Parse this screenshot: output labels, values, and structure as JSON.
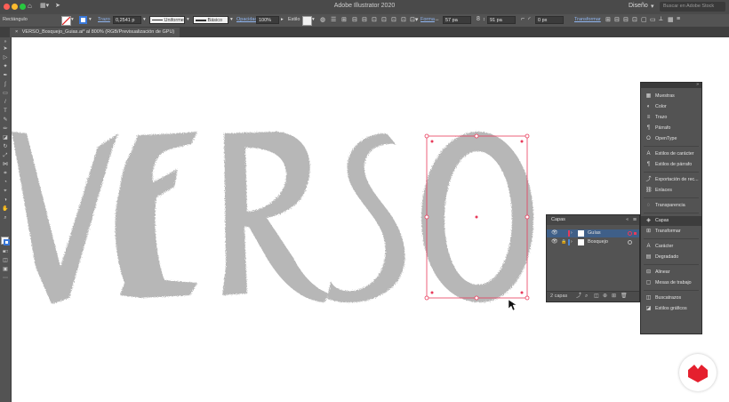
{
  "app": {
    "title": "Adobe Illustrator 2020",
    "workspace": "Diseño",
    "stock_search_placeholder": "Buscar en Adobe Stock"
  },
  "control_bar": {
    "object_type": "Rectángulo",
    "stroke_label": "Trazo",
    "stroke_value": "0,2541 p",
    "profile": "Uniforme",
    "brush": "Básico",
    "opacity_label": "Opacidad",
    "opacity_value": "100%",
    "style_label": "Estilo",
    "shape_label": "Forma",
    "width_value": "57 pa",
    "height_value": "91 pa",
    "corner_value": "0 px",
    "transform_label": "Transformar"
  },
  "document_tab": {
    "label": "VERSO_Bosquejo_Guias.ai* al 800% (RGB/Previsualización de GPU)",
    "close": "×"
  },
  "layers_panel": {
    "title": "Capas",
    "layers": [
      {
        "name": "Guías",
        "selected": true,
        "color": "#e83a5a"
      },
      {
        "name": "Bosquejo",
        "selected": false,
        "color": "#4a86d8"
      }
    ],
    "footer_count": "2 capas"
  },
  "dock": {
    "items": [
      {
        "label": "Muestras",
        "icon": "grid-icon"
      },
      {
        "label": "Color",
        "icon": "color-icon"
      },
      {
        "label": "Trazo",
        "icon": "stroke-icon"
      },
      {
        "label": "Párrafo",
        "icon": "paragraph-icon"
      },
      {
        "label": "OpenType",
        "icon": "opentype-icon"
      },
      {
        "label": "Estilos de carácter",
        "icon": "char-style-icon"
      },
      {
        "label": "Estilos de párrafo",
        "icon": "para-style-icon"
      },
      {
        "label": "Exportación de rec...",
        "icon": "export-icon"
      },
      {
        "label": "Enlaces",
        "icon": "link-icon"
      },
      {
        "label": "Transparencia",
        "icon": "transparency-icon"
      },
      {
        "label": "Capas",
        "icon": "layers-icon",
        "active": true
      },
      {
        "label": "Transformar",
        "icon": "transform-icon"
      },
      {
        "label": "Carácter",
        "icon": "character-icon"
      },
      {
        "label": "Degradado",
        "icon": "gradient-icon"
      },
      {
        "label": "Alinear",
        "icon": "align-icon"
      },
      {
        "label": "Mesas de trabajo",
        "icon": "artboards-icon"
      },
      {
        "label": "Buscatrazos",
        "icon": "pathfinder-icon"
      },
      {
        "label": "Estilos gráficos",
        "icon": "graphic-styles-icon"
      }
    ]
  },
  "colors": {
    "accent_selection": "#e83a5a",
    "sketch": "#b4b4b4",
    "panel": "#535353",
    "brand_logo": "#e5202e"
  }
}
